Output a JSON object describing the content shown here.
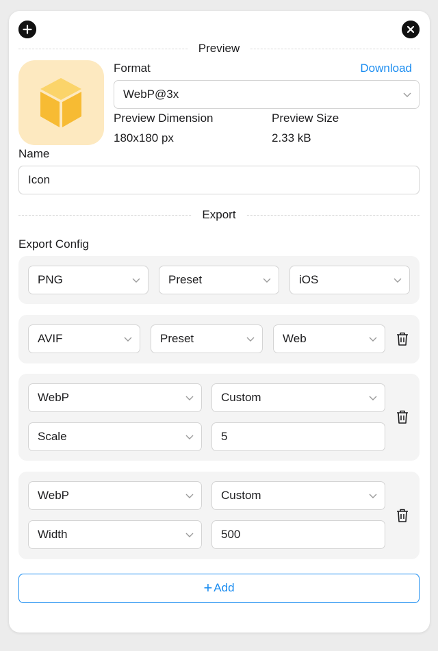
{
  "header": {
    "add_icon": "plus-circle-icon",
    "close_icon": "close-circle-icon"
  },
  "preview": {
    "section_title": "Preview",
    "thumbnail_icon": "cube-icon",
    "format_label": "Format",
    "download_label": "Download",
    "format_value": "WebP@3x",
    "dimension_label": "Preview Dimension",
    "dimension_value": "180x180 px",
    "size_label": "Preview Size",
    "size_value": "2.33 kB"
  },
  "name": {
    "label": "Name",
    "value": "Icon"
  },
  "export": {
    "section_title": "Export",
    "config_label": "Export Config",
    "configs": [
      {
        "format": "PNG",
        "mode": "Preset",
        "preset": "iOS"
      },
      {
        "format": "AVIF",
        "mode": "Preset",
        "preset": "Web"
      },
      {
        "format": "WebP",
        "mode": "Custom",
        "param": "Scale",
        "value": "5"
      },
      {
        "format": "WebP",
        "mode": "Custom",
        "param": "Width",
        "value": "500"
      }
    ],
    "add_label": "Add"
  },
  "colors": {
    "accent": "#1a8cf0",
    "thumbnail_bg": "#fde9c0",
    "cube": "#f7bb33"
  }
}
